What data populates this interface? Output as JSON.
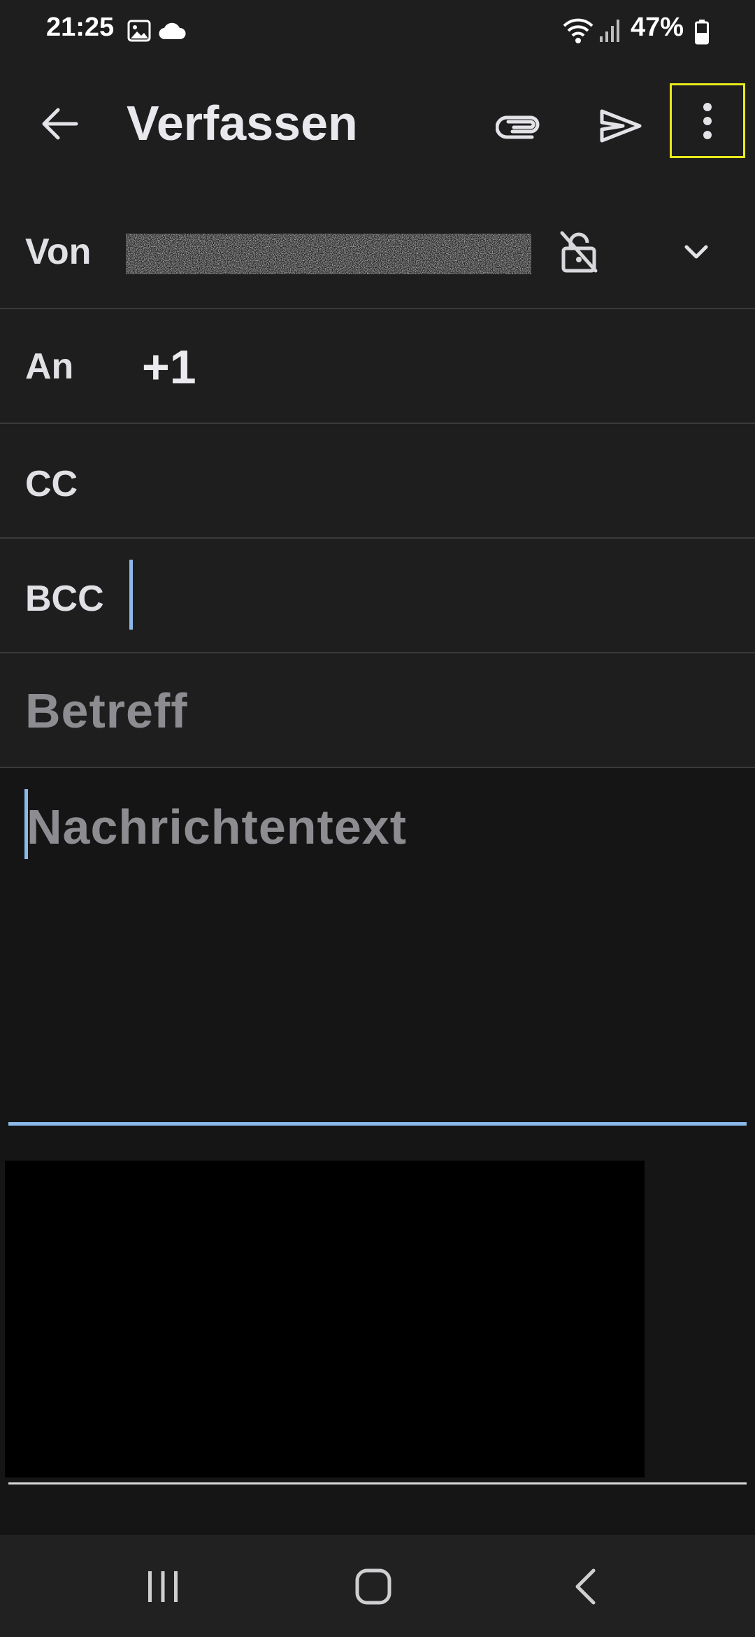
{
  "status_bar": {
    "time": "21:25",
    "battery": "47%",
    "icons": [
      "gallery-icon",
      "cloud-icon",
      "wifi-icon",
      "signal-icon",
      "battery-icon"
    ]
  },
  "toolbar": {
    "title": "Verfassen",
    "icons": [
      "back-arrow-icon",
      "paperclip-icon",
      "send-icon",
      "more-vert-icon"
    ]
  },
  "compose": {
    "from": {
      "label": "Von",
      "value_redacted": true
    },
    "to": {
      "label": "An",
      "recipients": "+1"
    },
    "cc": {
      "label": "CC"
    },
    "bcc": {
      "label": "BCC"
    },
    "subject": {
      "placeholder": "Betreff"
    },
    "body": {
      "placeholder": "Nachrichtentext"
    }
  },
  "colors": {
    "background": "#1e1e1f",
    "body_background": "#151516",
    "accent_cursor": "#8ab9ea",
    "highlight_box": "#e9e91a"
  },
  "nav_bar": {
    "icons": [
      "recents-icon",
      "home-icon",
      "back-icon"
    ]
  }
}
